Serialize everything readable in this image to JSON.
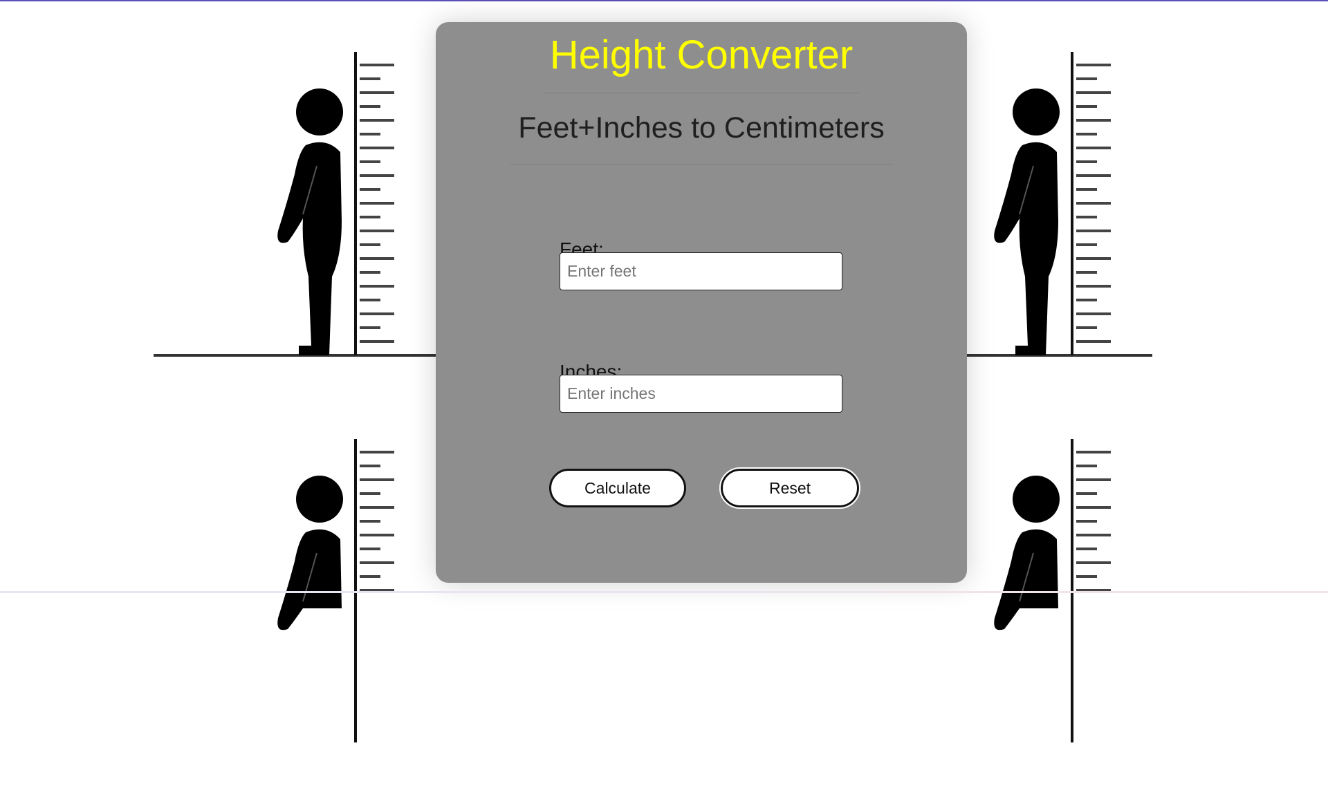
{
  "app": {
    "title": "Height Converter",
    "subtitle": "Feet+Inches to Centimeters"
  },
  "form": {
    "feet": {
      "label": "Feet:",
      "placeholder": "Enter feet",
      "value": ""
    },
    "inches": {
      "label": "Inches:",
      "placeholder": "Enter inches",
      "value": ""
    }
  },
  "buttons": {
    "calculate": "Calculate",
    "reset": "Reset"
  },
  "colors": {
    "title": "#ffff00",
    "card": "#8e8e8e",
    "background": "#ffffff",
    "accent_strip": "#5b4fb8"
  },
  "icons": {
    "background_figure": "person-height-chart-icon"
  }
}
